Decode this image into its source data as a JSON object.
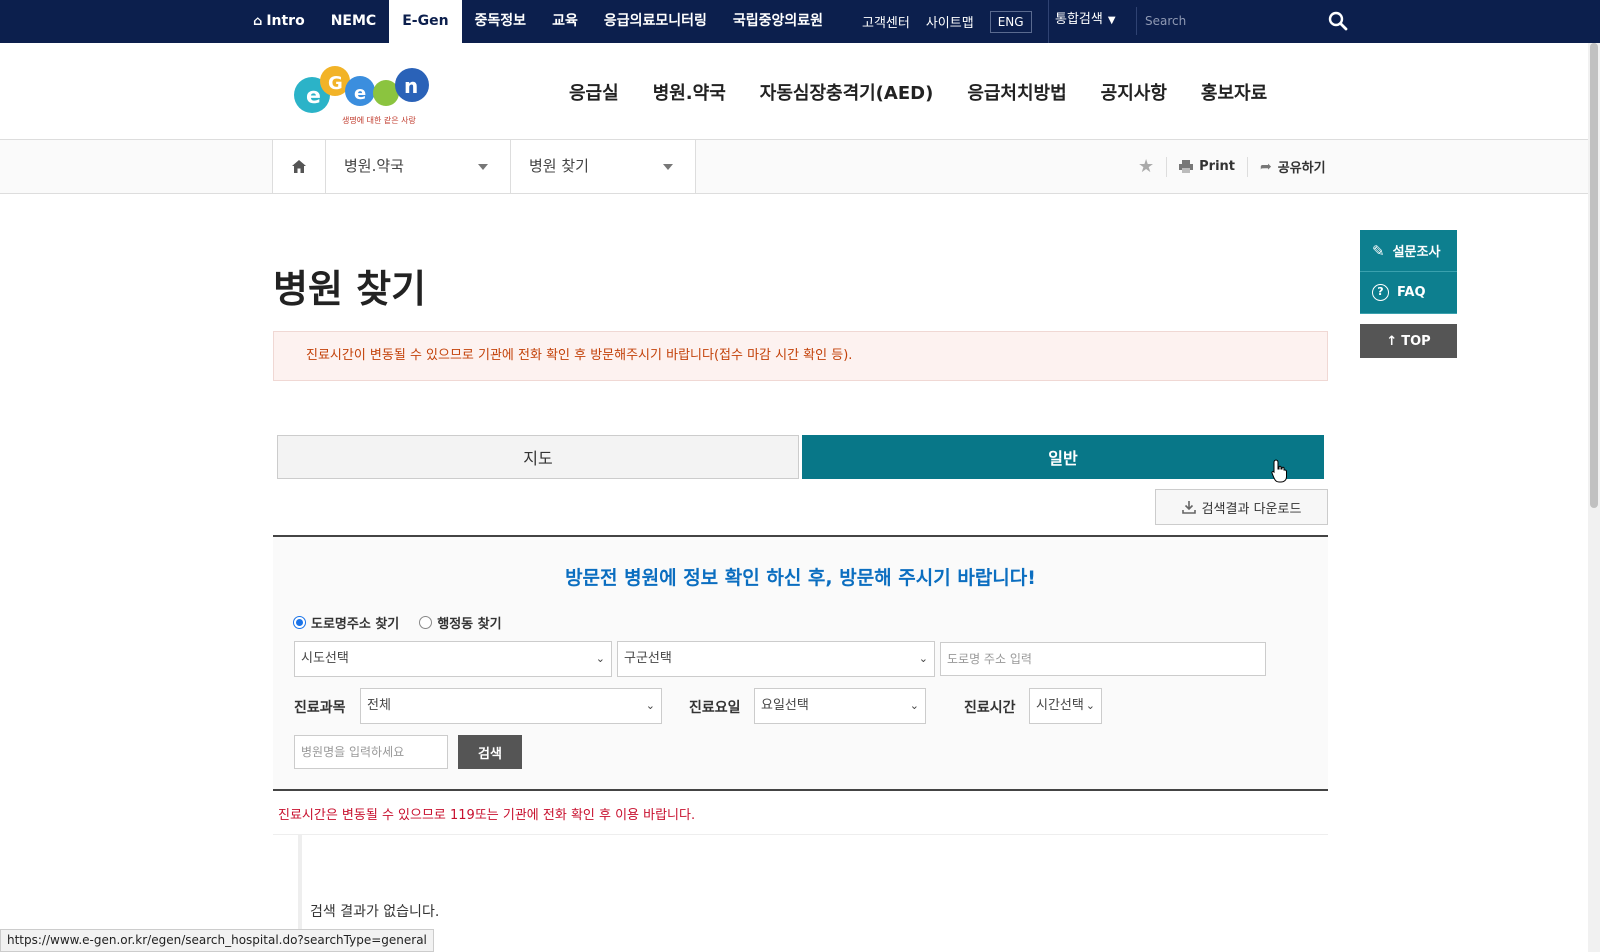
{
  "topbar": {
    "nav": [
      "Intro",
      "NEMC",
      "E-Gen",
      "중독정보",
      "교육",
      "응급의료모니터링",
      "국립중앙의료원"
    ],
    "active": "E-Gen",
    "links": [
      "고객센터",
      "사이트맵",
      "ENG"
    ],
    "search_scope": "통합검색",
    "search_placeholder": "Search"
  },
  "header": {
    "logo_text": "e-Gen",
    "logo_tagline": "생명에 대한 같은 사랑",
    "menu": [
      "응급실",
      "병원.약국",
      "자동심장충격기(AED)",
      "응급처치방법",
      "공지사항",
      "홍보자료"
    ]
  },
  "breadcrumb": {
    "level1": "병원.약국",
    "level2": "병원 찾기",
    "print": "Print",
    "share": "공유하기"
  },
  "quick_menu": {
    "survey": "설문조사",
    "faq": "FAQ",
    "top": "TOP"
  },
  "page": {
    "title": "병원 찾기",
    "notice": "진료시간이 변동될 수 있으므로 기관에 전화 확인 후 방문해주시기 바랍니다(접수 마감 시간 확인 등).",
    "tabs": {
      "map": "지도",
      "general": "일반"
    },
    "download": "검색결과 다운로드"
  },
  "search": {
    "heading": "방문전 병원에 정보 확인 하신 후, 방문해 주시기 바랍니다!",
    "radio_road": "도로명주소 찾기",
    "radio_admin": "행정동 찾기",
    "sido": "시도선택",
    "gugun": "구군선택",
    "road_placeholder": "도로명 주소 입력",
    "dept_label": "진료과목",
    "dept_value": "전체",
    "day_label": "진료요일",
    "day_value": "요일선택",
    "time_label": "진료시간",
    "time_value": "시간선택",
    "name_placeholder": "병원명을 입력하세요",
    "button": "검색"
  },
  "results": {
    "notice": "진료시간은 변동될 수 있으므로 119또는 기관에 전화 확인 후 이용 바랍니다.",
    "empty": "검색 결과가 없습니다."
  },
  "status_url": "https://www.e-gen.or.kr/egen/search_hospital.do?searchType=general",
  "colors": {
    "topbar": "#0c1f4d",
    "accent": "#087788",
    "notice": "#c3420a",
    "heading": "#0b6ec0"
  }
}
